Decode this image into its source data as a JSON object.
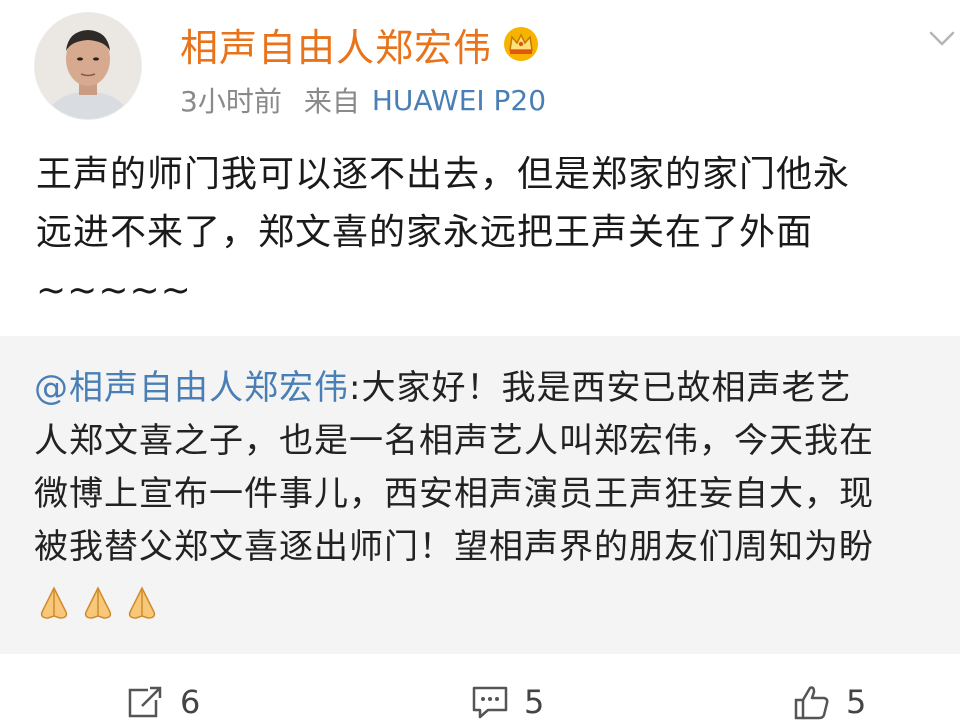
{
  "post": {
    "author": {
      "name": "相声自由人郑宏伟",
      "avatar_icon": "avatar-photo",
      "badge_icon": "crown-icon"
    },
    "meta": {
      "time": "3小时前",
      "source_prefix": "来自",
      "device": "HUAWEI P20"
    },
    "text_lines": [
      "王声的师门我可以逐不出去，但是郑家的家门他永",
      "远进不来了，郑文喜的家永远把王声关在了外面",
      "~~~~~"
    ],
    "repost": {
      "mention": "@相声自由人郑宏伟",
      "line1_rest": ":大家好！我是西安已故相声老艺",
      "lines": [
        "人郑文喜之子，也是一名相声艺人叫郑宏伟，今天我在",
        "微博上宣布一件事儿，西安相声演员王声狂妄自大，现",
        "被我替父郑文喜逐出师门！望相声界的朋友们周知为盼"
      ],
      "emoji": [
        "pray-icon",
        "pray-icon",
        "pray-icon"
      ]
    },
    "actions": {
      "repost_count": "6",
      "comment_count": "5",
      "like_count": "5"
    }
  },
  "colors": {
    "username": "#e8731a",
    "link": "#4a7fb5",
    "repost_bg": "#f4f4f4",
    "meta": "#8a8a8a"
  }
}
